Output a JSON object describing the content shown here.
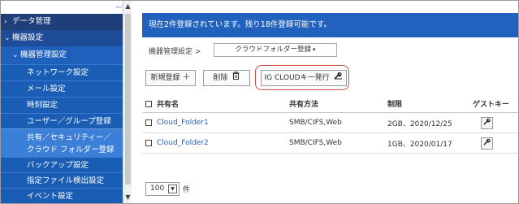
{
  "sidebar": {
    "top_link": "一覧",
    "items": [
      {
        "label": "データ管理",
        "caret": "›"
      },
      {
        "label": "機器設定",
        "caret": "⌄"
      },
      {
        "label": "機器管理設定",
        "caret": "⌄"
      },
      {
        "label": "ネットワーク設定"
      },
      {
        "label": "メール設定"
      },
      {
        "label": "時刻設定"
      },
      {
        "label": "ユーザー／グループ登録"
      },
      {
        "label": "共有／セキュリティー／",
        "label2": "クラウド フォルダー登録"
      },
      {
        "label": "バックアップ設定"
      },
      {
        "label": "指定ファイル検出設定"
      },
      {
        "label": "イベント設定"
      }
    ]
  },
  "banner": {
    "text": "現在2件登録されています。残り18件登録可能です。"
  },
  "breadcrumb": {
    "label": "機器管理設定 >",
    "select": "クラウドフォルダー登録"
  },
  "toolbar": {
    "new_label": "新規登録",
    "new_icon": "＋",
    "delete_label": "削除",
    "ig_label": "IG CLOUDキー発行"
  },
  "table": {
    "headers": {
      "name": "共有名",
      "protocol": "共有方法",
      "limit": "制限",
      "guest": "ゲストキー"
    },
    "rows": [
      {
        "name": "Cloud_Folder1",
        "protocol": "SMB/CIFS,Web",
        "limit": "2GB、2020/12/25"
      },
      {
        "name": "Cloud_Folder2",
        "protocol": "SMB/CIFS,Web",
        "limit": "1GB、2020/01/17"
      }
    ]
  },
  "pager": {
    "per_page": "100",
    "unit": "件"
  },
  "colors": {
    "sidebar": "#1a5db5",
    "banner": "#2262bf",
    "highlight": "#d44a3b",
    "link": "#2f5fb0"
  }
}
